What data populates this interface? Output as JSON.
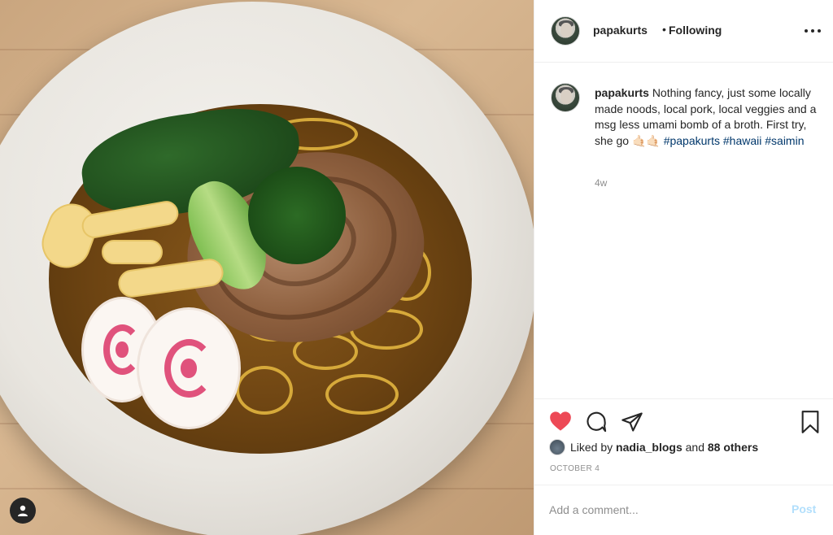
{
  "post": {
    "photo_alt": "Bowl of saimin with pork, greens, egg and fish cake"
  },
  "header": {
    "username": "papakurts",
    "separator": "•",
    "follow_status": "Following",
    "more_icon": "more-horizontal-icon"
  },
  "caption": {
    "username": "papakurts",
    "text": "Nothing fancy, just some locally made noods, local pork, local veggies and a msg less umami bomb of a broth. First try, she go ",
    "emoji": "🤙🏻🤙🏻",
    "hashtags": [
      "#papakurts",
      "#hawaii",
      "#saimin"
    ],
    "time_ago": "4w"
  },
  "actions": {
    "liked": true,
    "like_color": "#ed4956",
    "icons": [
      "heart-icon",
      "comment-icon",
      "share-icon",
      "bookmark-icon"
    ]
  },
  "likes": {
    "prefix": "Liked by ",
    "user": "nadia_blogs",
    "middle": " and ",
    "others": "88 others"
  },
  "date": "OCTOBER 4",
  "comment": {
    "placeholder": "Add a comment...",
    "post_label": "Post"
  }
}
